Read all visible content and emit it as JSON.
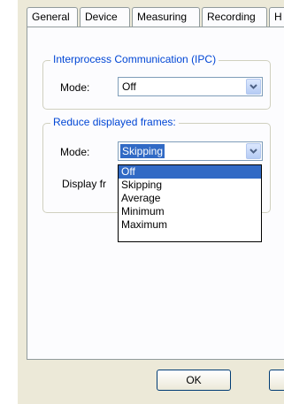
{
  "tabs": [
    "General",
    "Device",
    "Measuring",
    "Recording",
    "H"
  ],
  "ipc_group": {
    "title": "Interprocess Communication (IPC)",
    "mode_label": "Mode:",
    "mode_value": "Off"
  },
  "reduce_group": {
    "title": "Reduce displayed frames:",
    "mode_label": "Mode:",
    "mode_value": "Skipping",
    "display_label": "Display fr"
  },
  "dropdown_options": [
    "Off",
    "Skipping",
    "Average",
    "Minimum",
    "Maximum"
  ],
  "dropdown_highlighted": "Off",
  "buttons": {
    "ok": "OK",
    "partial": ""
  },
  "icons": {
    "combo_arrow": "chevron-down-icon"
  },
  "colors": {
    "group_title": "#0046d5",
    "selection": "#316ac5",
    "dialog_bg": "#ece9d8"
  }
}
